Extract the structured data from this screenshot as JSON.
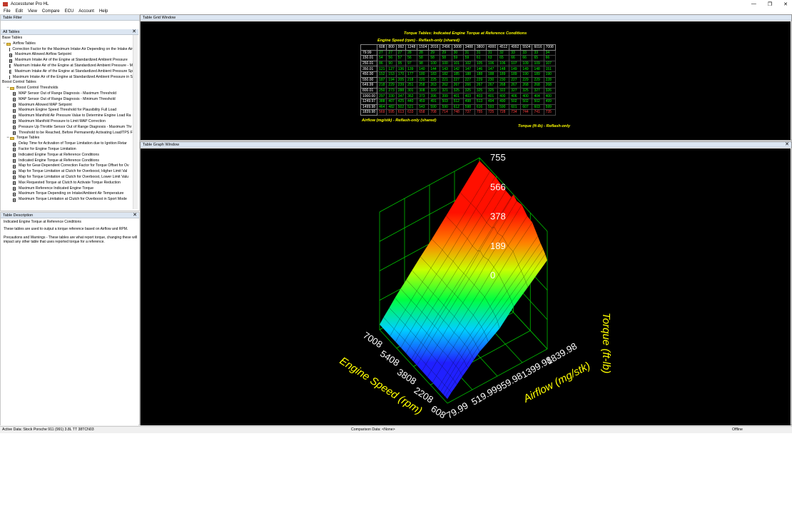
{
  "window": {
    "title": "Accesstuner Pro HL",
    "controls": [
      "—",
      "❐",
      "✕"
    ]
  },
  "menu": [
    "File",
    "Edit",
    "View",
    "Compare",
    "ECU",
    "Account",
    "Help"
  ],
  "panels": {
    "filter": "Table Filter",
    "all_tables": "All Tables",
    "description": "Table Description",
    "grid": "Table Grid Window",
    "graph": "Table Graph Window",
    "close": "✕"
  },
  "tree": [
    {
      "level": 0,
      "type": "label",
      "label": "Base Tables"
    },
    {
      "level": 0,
      "type": "folder",
      "label": "Airflow Tables",
      "toggle": "−"
    },
    {
      "level": 2,
      "type": "doc",
      "label": "Correction Factor for the Maximum Intake Air Depending on the Intake Air"
    },
    {
      "level": 2,
      "type": "doc",
      "label": "Maximum Allowed Airflow Setpoint"
    },
    {
      "level": 2,
      "type": "doc",
      "label": "Maximum Intake Air of the Engine at Standardized Ambient Pressure"
    },
    {
      "level": 2,
      "type": "doc",
      "label": "Maximum Intake Air of the Engine at Standardized Ambient Pressure - M"
    },
    {
      "level": 2,
      "type": "doc",
      "label": "Maximum Intake Air of the Engine at Standardized Ambient Pressure Sp"
    },
    {
      "level": 2,
      "type": "doc",
      "label": "Maximum Intake Air of the Engine at Standardized Ambient Pressure in S"
    },
    {
      "level": 0,
      "type": "label",
      "label": "Boost Control Tables"
    },
    {
      "level": 1,
      "type": "folder",
      "label": "Boost Control Thresholds",
      "toggle": "−"
    },
    {
      "level": 3,
      "type": "doc",
      "label": "MAP Sensor Out of Range Diagnosis - Maximum Threshold"
    },
    {
      "level": 3,
      "type": "doc",
      "label": "MAP Sensor Out of Range Diagnosis - Minimum Threshold"
    },
    {
      "level": 3,
      "type": "doc",
      "label": "Maximum Allowed MAP Setpoint"
    },
    {
      "level": 3,
      "type": "doc",
      "label": "Maximum Engine Speed Threshold for Plausibility Full Load"
    },
    {
      "level": 3,
      "type": "doc",
      "label": "Maximum Manifold Air Pressure Value to Determine Engine Load Ra"
    },
    {
      "level": 3,
      "type": "doc",
      "label": "Maximum Manifold Pressure to Limit MAP Correction"
    },
    {
      "level": 3,
      "type": "doc",
      "label": "Pressure Up Throttle Sensor Out of Range Diagnosis - Maximum Thr"
    },
    {
      "level": 3,
      "type": "doc",
      "label": "Threshold to be Reached, Before Permanently Activating Load/TPS F"
    },
    {
      "level": 1,
      "type": "folder",
      "label": "Torque Tables",
      "toggle": "−"
    },
    {
      "level": 3,
      "type": "doc",
      "label": "Delay Time for Activation of Torque Limitation due to Ignition Retar"
    },
    {
      "level": 3,
      "type": "doc",
      "label": "Factor for Engine Torque Limitation"
    },
    {
      "level": 3,
      "type": "doc",
      "label": "Indicated Engine Torque at Reference Conditions",
      "selected": true
    },
    {
      "level": 3,
      "type": "doc",
      "label": "Indicated Engine Torque at Reference Conditions"
    },
    {
      "level": 3,
      "type": "doc",
      "label": "Map for Gear-Dependent Correction Factor for Torque Offset for Ov"
    },
    {
      "level": 3,
      "type": "doc",
      "label": "Map for Torque Limitation at Clutch for Overboost, Higher Limit Val"
    },
    {
      "level": 3,
      "type": "doc",
      "label": "Map for Torque Limitation at Clutch for Overboost, Lower Limit Valu"
    },
    {
      "level": 3,
      "type": "doc",
      "label": "Max Requested Torque at Clutch to Activate Torque Reduction"
    },
    {
      "level": 3,
      "type": "doc",
      "label": "Maximum Reference Indicated Engine Torque"
    },
    {
      "level": 3,
      "type": "doc",
      "label": "Maximum Torque Depending on Intake/Ambient Air Temperature"
    },
    {
      "level": 3,
      "type": "doc",
      "label": "Maximum Torque Limitation at Clutch for Overboost in Sport Mode"
    }
  ],
  "description": {
    "name": "Indicated Engine Torque at Reference Conditions",
    "line1": "These tables are used to output a torque reference based on Airflow and RPM.",
    "line2": "Precautions and Warnings - These tables are what report torque, changing these will",
    "line3": "impact any other table that uses reported torque for a reference."
  },
  "grid": {
    "title": "Torque Tables: Indicated Engine Torque at Reference Conditions",
    "col_axis": "Engine Speed (rpm) - Reflash-only (shared)",
    "row_axis": "Airflow (mg/stk) - Reflash-only (shared)",
    "value_axis": "Torque (ft-lb) - Reflash-only",
    "cols": [
      "608",
      "800",
      "992",
      "1248",
      "1504",
      "2016",
      "2496",
      "3008",
      "3488",
      "3800",
      "4000",
      "4512",
      "4992",
      "5504",
      "6016",
      "7008"
    ],
    "rows": [
      {
        "h": "79.99",
        "v": [
          "27",
          "27",
          "27",
          "28",
          "28",
          "29",
          "29",
          "30",
          "31",
          "31",
          "31",
          "32",
          "33",
          "33",
          "33",
          "34"
        ]
      },
      {
        "h": "150.01",
        "v": [
          "54",
          "56",
          "57",
          "56",
          "58",
          "58",
          "58",
          "59",
          "59",
          "61",
          "63",
          "65",
          "66",
          "66",
          "65",
          "66"
        ]
      },
      {
        "h": "250.01",
        "v": [
          "86",
          "90",
          "95",
          "97",
          "98",
          "100",
          "100",
          "101",
          "102",
          "105",
          "106",
          "106",
          "107",
          "109",
          "109",
          "107"
        ]
      },
      {
        "h": "350.01",
        "v": [
          "121",
          "127",
          "136",
          "139",
          "140",
          "144",
          "143",
          "142",
          "147",
          "146",
          "147",
          "148",
          "149",
          "149",
          "148",
          "151"
        ]
      },
      {
        "h": "450.00",
        "v": [
          "152",
          "153",
          "170",
          "177",
          "180",
          "183",
          "182",
          "185",
          "188",
          "188",
          "188",
          "189",
          "189",
          "190",
          "189",
          "190"
        ]
      },
      {
        "h": "550.00",
        "v": [
          "187",
          "194",
          "205",
          "218",
          "220",
          "225",
          "221",
          "227",
          "227",
          "229",
          "230",
          "230",
          "227",
          "229",
          "229",
          "228"
        ]
      },
      {
        "h": "649.99",
        "v": [
          "218",
          "229",
          "239",
          "251",
          "258",
          "263",
          "262",
          "267",
          "266",
          "267",
          "267",
          "268",
          "267",
          "268",
          "268",
          "268"
        ]
      },
      {
        "h": "800.01",
        "v": [
          "250",
          "273",
          "288",
          "301",
          "308",
          "320",
          "321",
          "325",
          "325",
          "325",
          "325",
          "322",
          "327",
          "325",
          "327",
          "326"
        ]
      },
      {
        "h": "1000.00",
        "v": [
          "297",
          "330",
          "347",
          "362",
          "373",
          "396",
          "399",
          "401",
          "403",
          "403",
          "401",
          "400",
          "406",
          "400",
          "404",
          "400"
        ]
      },
      {
        "h": "1249.97",
        "v": [
          "388",
          "407",
          "425",
          "440",
          "459",
          "491",
          "503",
          "512",
          "498",
          "513",
          "494",
          "490",
          "502",
          "502",
          "502",
          "499"
        ]
      },
      {
        "h": "1499.98",
        "v": [
          "464",
          "482",
          "502",
          "521",
          "543",
          "590",
          "590",
          "612",
          "598",
          "616",
          "593",
          "590",
          "601",
          "607",
          "603",
          "599"
        ]
      },
      {
        "h": "1839.98",
        "v": [
          "569",
          "595",
          "613",
          "633",
          "658",
          "708",
          "714",
          "748",
          "737",
          "755",
          "725",
          "728",
          "734",
          "744",
          "741",
          "735"
        ]
      }
    ]
  },
  "graph": {
    "z_ticks": [
      "755",
      "566",
      "378",
      "189",
      "0"
    ],
    "rpm_ticks": [
      "7008",
      "5408",
      "3808",
      "2208",
      "608"
    ],
    "air_ticks": [
      "1839.98",
      "1399.98",
      "959.98",
      "519.99",
      "79.99"
    ],
    "z_label": "Torque (ft-lb)",
    "rpm_label": "Engine Speed (rpm)",
    "air_label": "Airflow (mg/stk)"
  },
  "status": {
    "active": "Active Data: Stock Porsche 911 (991) 3.8L TT 38TCN03",
    "comparison": "Comparison Data: <None>",
    "mode": "Offline"
  }
}
